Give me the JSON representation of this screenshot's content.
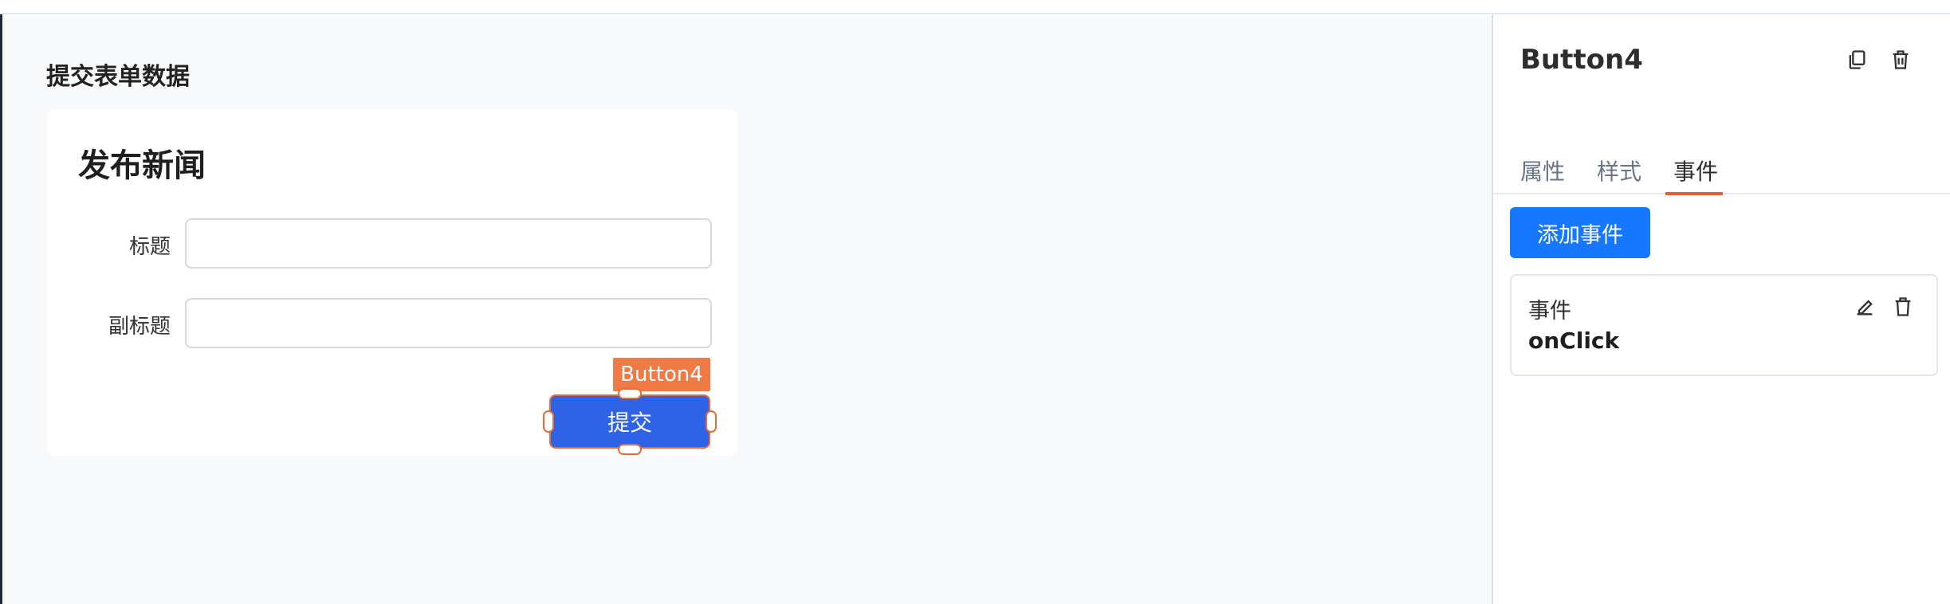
{
  "canvas": {
    "page_title": "提交表单数据",
    "form": {
      "title": "发布新闻",
      "fields": [
        {
          "label": "标题",
          "value": "",
          "placeholder": ""
        },
        {
          "label": "副标题",
          "value": "",
          "placeholder": ""
        }
      ],
      "submit_label": "提交",
      "selected_component_tag": "Button4"
    }
  },
  "panel": {
    "component_name": "Button4",
    "header_icons": [
      "copy-icon",
      "trash-icon"
    ],
    "tabs": [
      {
        "label": "属性",
        "active": false
      },
      {
        "label": "样式",
        "active": false
      },
      {
        "label": "事件",
        "active": true
      }
    ],
    "add_event_label": "添加事件",
    "events": [
      {
        "label": "事件",
        "name": "onClick",
        "icons": [
          "edit-icon",
          "trash-icon"
        ]
      }
    ]
  },
  "colors": {
    "accent_blue": "#1677ff",
    "button_blue": "#2e63e8",
    "selection_orange": "#f07a45",
    "tab_active_underline": "#f05a28"
  }
}
